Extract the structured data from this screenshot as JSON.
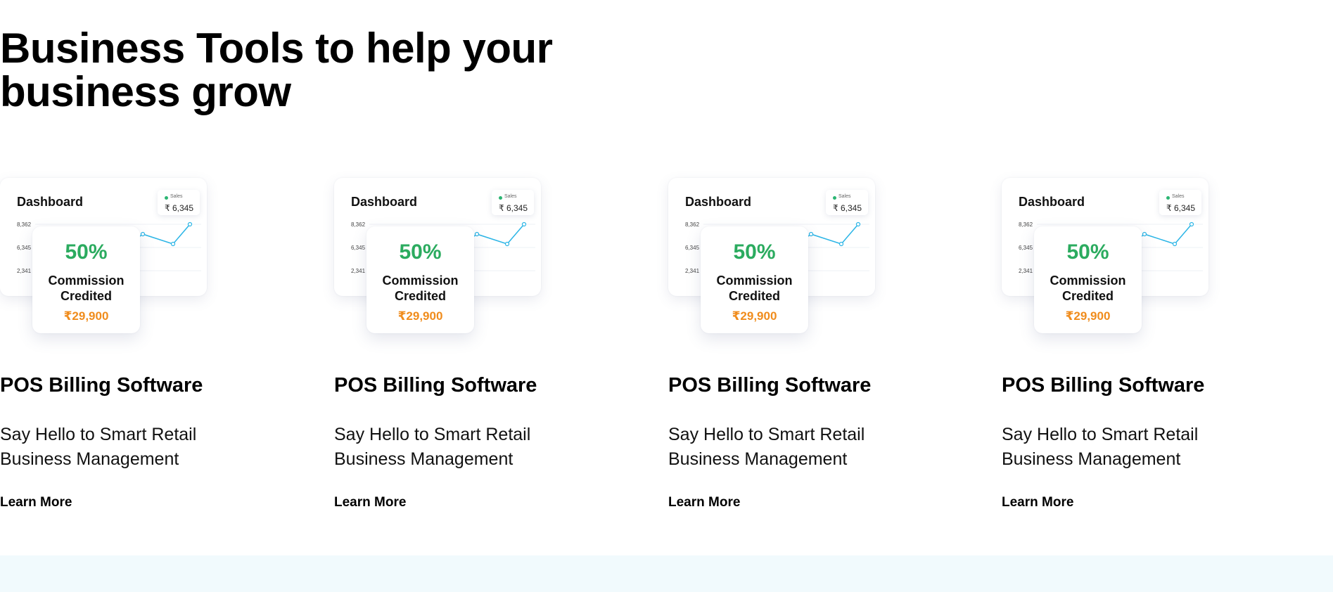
{
  "section": {
    "heading": "Business Tools to help your business grow"
  },
  "colors": {
    "accent_green": "#2bab5f",
    "accent_orange": "#f08c1c",
    "chart_line": "#2bb5e6",
    "footer_band": "#f1fafd"
  },
  "cards": [
    {
      "dashboard": {
        "title": "Dashboard",
        "sales_label": "Sales",
        "sales_value": "₹ 6,345",
        "y_ticks": [
          "8,362",
          "6,345",
          "2,341"
        ]
      },
      "commission": {
        "percent": "50%",
        "label": "Commission Credited",
        "amount": "₹29,900"
      },
      "title": "POS Billing Software",
      "description": "Say Hello to Smart Retail Business Management",
      "link": "Learn More"
    },
    {
      "dashboard": {
        "title": "Dashboard",
        "sales_label": "Sales",
        "sales_value": "₹ 6,345",
        "y_ticks": [
          "8,362",
          "6,345",
          "2,341"
        ]
      },
      "commission": {
        "percent": "50%",
        "label": "Commission Credited",
        "amount": "₹29,900"
      },
      "title": "POS Billing Software",
      "description": "Say Hello to Smart Retail Business Management",
      "link": "Learn More"
    },
    {
      "dashboard": {
        "title": "Dashboard",
        "sales_label": "Sales",
        "sales_value": "₹ 6,345",
        "y_ticks": [
          "8,362",
          "6,345",
          "2,341"
        ]
      },
      "commission": {
        "percent": "50%",
        "label": "Commission Credited",
        "amount": "₹29,900"
      },
      "title": "POS Billing Software",
      "description": "Say Hello to Smart Retail Business Management",
      "link": "Learn More"
    },
    {
      "dashboard": {
        "title": "Dashboard",
        "sales_label": "Sales",
        "sales_value": "₹ 6,345",
        "y_ticks": [
          "8,362",
          "6,345",
          "2,341"
        ]
      },
      "commission": {
        "percent": "50%",
        "label": "Commission Credited",
        "amount": "₹29,900"
      },
      "title": "POS Billing Software",
      "description": "Say Hello to Smart Retail Business Management",
      "link": "Learn More"
    }
  ]
}
